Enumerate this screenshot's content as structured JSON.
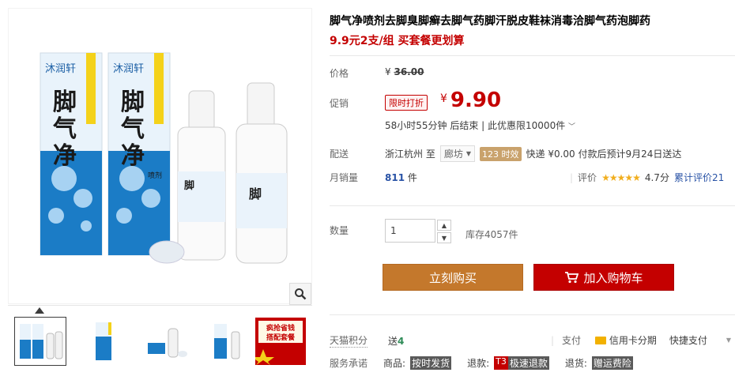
{
  "product": {
    "title": "脚气净喷剂去脚臭脚癣去脚气药脚汗脱皮鞋袜消毒洽脚气药泡脚药",
    "subtitle": "9.9元2支/组 买套餐更划算"
  },
  "image": {
    "brand": "沐润轩",
    "name_line1": "脚",
    "name_line2": "气",
    "name_line3": "净",
    "spray_label": "喷剂"
  },
  "price": {
    "label": "价格",
    "currency": "¥",
    "original": "36.00"
  },
  "promo": {
    "label": "促销",
    "tag": "限时打折",
    "currency": "¥",
    "value": "9.90",
    "countdown": "58小时55分钟 后结束 | 此优惠限10000件"
  },
  "shipping": {
    "label": "配送",
    "from": "浙江杭州 至",
    "to": "廊坊",
    "speed_tag": "123 时效",
    "express": "快递 ¥0.00 付款后预计9月24日送达"
  },
  "sales": {
    "label": "月销量",
    "count": "811",
    "unit": "件",
    "review_label": "评价",
    "stars": "★★★★★",
    "rating": "4.7分",
    "review_count": "累计评价21"
  },
  "quantity": {
    "label": "数量",
    "value": "1",
    "stock": "库存4057件"
  },
  "buttons": {
    "buy_now": "立刻购买",
    "add_cart": "加入购物车"
  },
  "points": {
    "label": "天猫积分",
    "prefix": "送",
    "value": "4"
  },
  "payment": {
    "label": "支付",
    "credit": "信用卡分期",
    "quick": "快捷支付"
  },
  "service": {
    "label": "服务承诺",
    "goods_label": "商品:",
    "goods_tag": "按时发货",
    "refund_label": "退款:",
    "refund_t3": "T3",
    "refund_tag": "极速退款",
    "return_label": "退货:",
    "return_tag": "赠运费险"
  },
  "thumb5": {
    "line1": "疯抢省钱",
    "line2": "搭配套餐"
  },
  "colors": {
    "accent": "#c40000",
    "buy_button": "#c4782c",
    "sales_count": "#2953a6",
    "stars": "#f1ae1e"
  }
}
